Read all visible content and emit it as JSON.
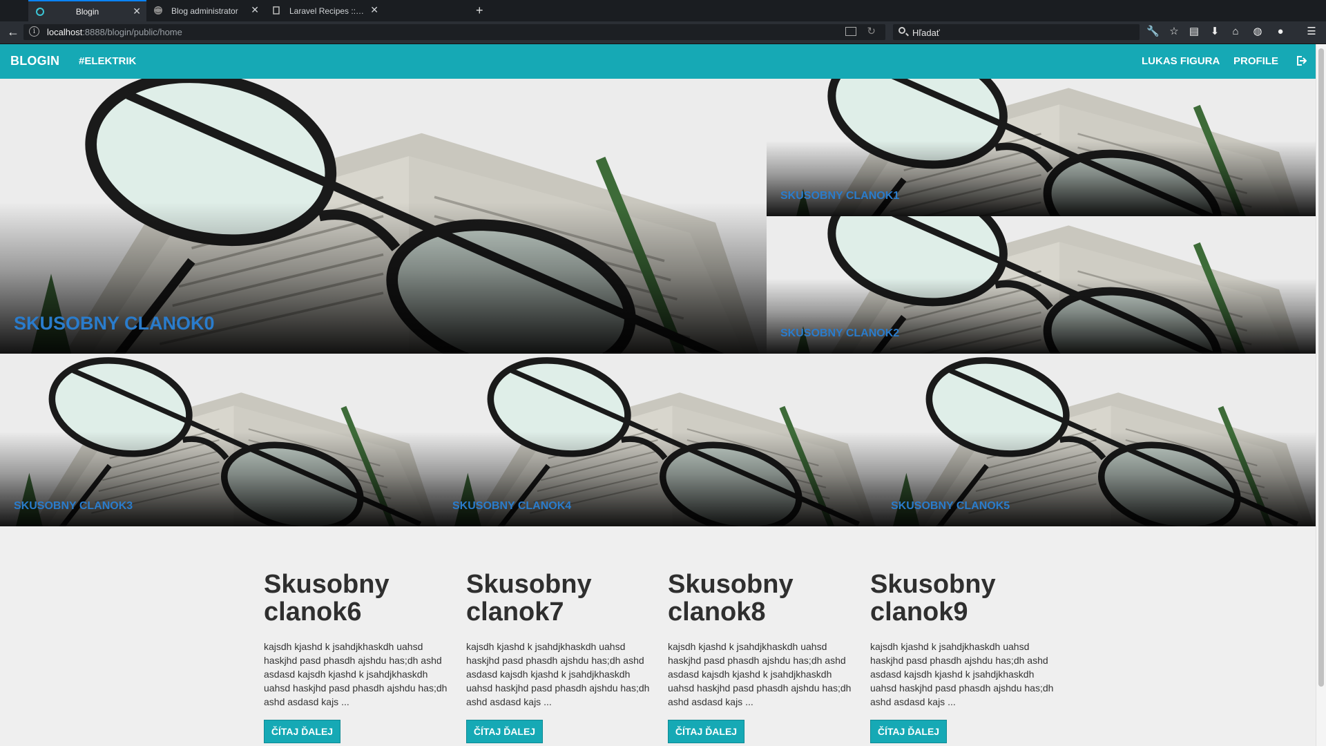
{
  "browser": {
    "tabs": [
      {
        "title": "Blogin",
        "active": true
      },
      {
        "title": "Blog administrator",
        "active": false
      },
      {
        "title": "Laravel Recipes :: Creating ...",
        "active": false
      }
    ],
    "url_host": "localhost",
    "url_rest": ":8888/blogin/public/home",
    "search_placeholder": "Hľadať"
  },
  "header": {
    "brand": "BLOGIN",
    "tag_link": "#ELEKTRIK",
    "user_name": "LUKAS FIGURA",
    "profile": "PROFILE"
  },
  "featured": [
    {
      "title": "SKUSOBNY CLANOK0"
    },
    {
      "title": "SKUSOBNY CLANOK1"
    },
    {
      "title": "SKUSOBNY CLANOK2"
    },
    {
      "title": "SKUSOBNY CLANOK3"
    },
    {
      "title": "SKUSOBNY CLANOK4"
    },
    {
      "title": "SKUSOBNY CLANOK5"
    }
  ],
  "articles": [
    {
      "title": "Skusobny clanok6",
      "excerpt": "kajsdh kjashd k jsahdjkhaskdh uahsd haskjhd pasd phasdh ajshdu has;dh ashd asdasd kajsdh kjashd k jsahdjkhaskdh uahsd haskjhd pasd phasdh ajshdu has;dh ashd asdasd kajs ...",
      "button": "ČÍTAJ ĎALEJ"
    },
    {
      "title": "Skusobny clanok7",
      "excerpt": "kajsdh kjashd k jsahdjkhaskdh uahsd haskjhd pasd phasdh ajshdu has;dh ashd asdasd kajsdh kjashd k jsahdjkhaskdh uahsd haskjhd pasd phasdh ajshdu has;dh ashd asdasd kajs ...",
      "button": "ČÍTAJ ĎALEJ"
    },
    {
      "title": "Skusobny clanok8",
      "excerpt": "kajsdh kjashd k jsahdjkhaskdh uahsd haskjhd pasd phasdh ajshdu has;dh ashd asdasd kajsdh kjashd k jsahdjkhaskdh uahsd haskjhd pasd phasdh ajshdu has;dh ashd asdasd kajs ...",
      "button": "ČÍTAJ ĎALEJ"
    },
    {
      "title": "Skusobny clanok9",
      "excerpt": "kajsdh kjashd k jsahdjkhaskdh uahsd haskjhd pasd phasdh ajshdu has;dh ashd asdasd kajsdh kjashd k jsahdjkhaskdh uahsd haskjhd pasd phasdh ajshdu has;dh ashd asdasd kajs ...",
      "button": "ČÍTAJ ĎALEJ"
    }
  ],
  "colors": {
    "accent": "#16a9b5",
    "tile_title": "#2a7ccc"
  }
}
